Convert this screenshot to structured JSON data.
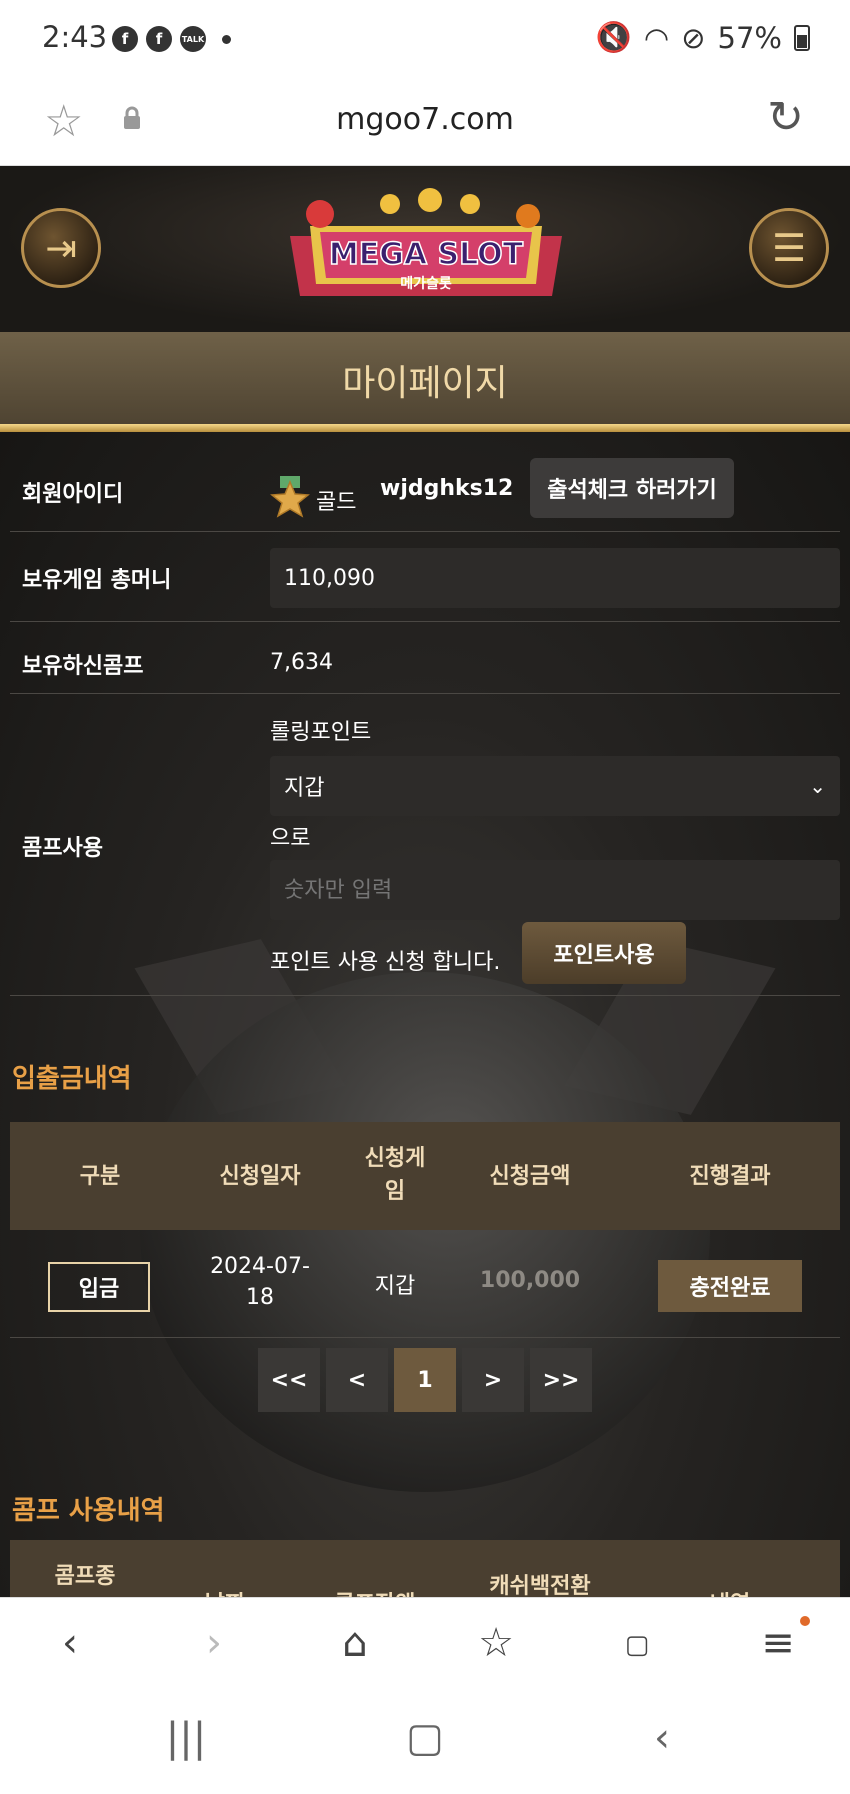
{
  "status_bar": {
    "time": "2:43",
    "battery": "57%",
    "notifications": [
      "facebook-icon",
      "facebook-icon",
      "kakaotalk-icon",
      "dot-icon"
    ],
    "talk_label": "TALK"
  },
  "browser": {
    "url": "mgoo7.com"
  },
  "header": {
    "logo_text": "MEGA SLOT",
    "logo_sub": "메가슬롯"
  },
  "page": {
    "title": "마이페이지"
  },
  "profile": {
    "member_id_label": "회원아이디",
    "grade": "골드",
    "member_id": "wjdghks12",
    "attendance_button": "출석체크 하러가기",
    "game_money_label": "보유게임 총머니",
    "game_money": "110,090",
    "comp_label": "보유하신콤프",
    "comp_value": "7,634",
    "comp_use_label": "콤프사용",
    "rolling_label": "롤링포인트",
    "wallet_select": "지갑",
    "to_label": "으로",
    "amount_placeholder": "숫자만 입력",
    "request_text": "포인트 사용 신청 합니다.",
    "use_point_button": "포인트사용"
  },
  "transactions": {
    "title": "입출금내역",
    "headers": [
      "구분",
      "신청일자",
      "신청게\n임",
      "신청금액",
      "진행결과"
    ],
    "rows": [
      {
        "type": "입금",
        "date": "2024-07-\n18",
        "game": "지갑",
        "amount": "100,000",
        "result": "충전완료"
      }
    ]
  },
  "pagination": {
    "first": "<<",
    "prev": "<",
    "current": "1",
    "next": ">",
    "last": ">>"
  },
  "comp_history": {
    "title": "콤프 사용내역",
    "headers": [
      "콤프종",
      "날짜",
      "콤프잔액",
      "캐쉬백전환",
      "내역"
    ]
  },
  "colors": {
    "accent_orange": "#e8a047",
    "gold": "#f0d9a8",
    "brown": "#6e5a3e"
  }
}
